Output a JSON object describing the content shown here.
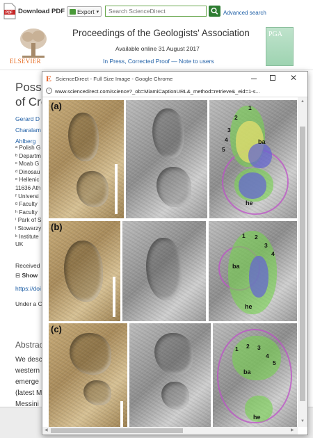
{
  "toolbar": {
    "download_pdf": "Download PDF",
    "export": "Export",
    "search_placeholder": "Search ScienceDirect",
    "advanced_search": "Advanced search"
  },
  "journal": {
    "publisher": "ELSEVIER",
    "title": "Proceedings of the Geologists' Association",
    "available": "Available online 31 August 2017",
    "in_press": "In Press, Corrected Proof — Note to users",
    "cover_abbrev": "PGA"
  },
  "article": {
    "title_lines": [
      "Possi",
      "of Cre"
    ],
    "author_lines": [
      "Gerard D",
      "Charalam",
      "Ahlberg"
    ],
    "affiliations": [
      "ᵃ Polish G",
      "ᵇ Departm",
      "ᶜ Moab G",
      "ᵈ Dinosau",
      "ᵉ Hellenic",
      "11636 Ath",
      "ᶠ Universi",
      "ᵍ Faculty",
      "ʰ Faculty",
      "ⁱ Park of S",
      "ʲ Stowarzy",
      "ᵏ Institute",
      "UK"
    ],
    "received": "Received",
    "show_more": "Show",
    "doi": "https://doi",
    "license": "Under a C",
    "abstract_heading": "Abstrac",
    "abstract_lines": [
      "We desc",
      "western",
      "emerge",
      "(latest M",
      "Messini"
    ]
  },
  "popup": {
    "window_title": "ScienceDirect - Full Size Image - Google Chrome",
    "url": "www.sciencedirect.com/science?_ob=MiamiCaptionURL&_method=retrieve&_eid=1-s...",
    "rows": [
      {
        "label": "(a)",
        "digits": [
          "1",
          "2",
          "3",
          "4",
          "5"
        ],
        "zones": [
          "ba",
          "he"
        ]
      },
      {
        "label": "(b)",
        "digits": [
          "1",
          "2",
          "3",
          "4"
        ],
        "zones": [
          "ba",
          "he"
        ]
      },
      {
        "label": "(c)",
        "digits": [
          "1",
          "2",
          "3",
          "4",
          "5"
        ],
        "zones": [
          "ba",
          "he"
        ]
      }
    ]
  },
  "colors": {
    "link": "#1f5fa6",
    "elsevier_orange": "#e66a1f",
    "search_green": "#2e7d32",
    "zone_green": "#78d250",
    "zone_yellow": "#ebe16e",
    "zone_blue": "#6464d2",
    "zone_pink": "#be50c8"
  },
  "icons": [
    "pdf-icon",
    "export-icon",
    "search-icon",
    "elsevier-tree-logo",
    "info-icon",
    "minimize-icon",
    "maximize-icon",
    "close-icon",
    "expand-icon"
  ]
}
